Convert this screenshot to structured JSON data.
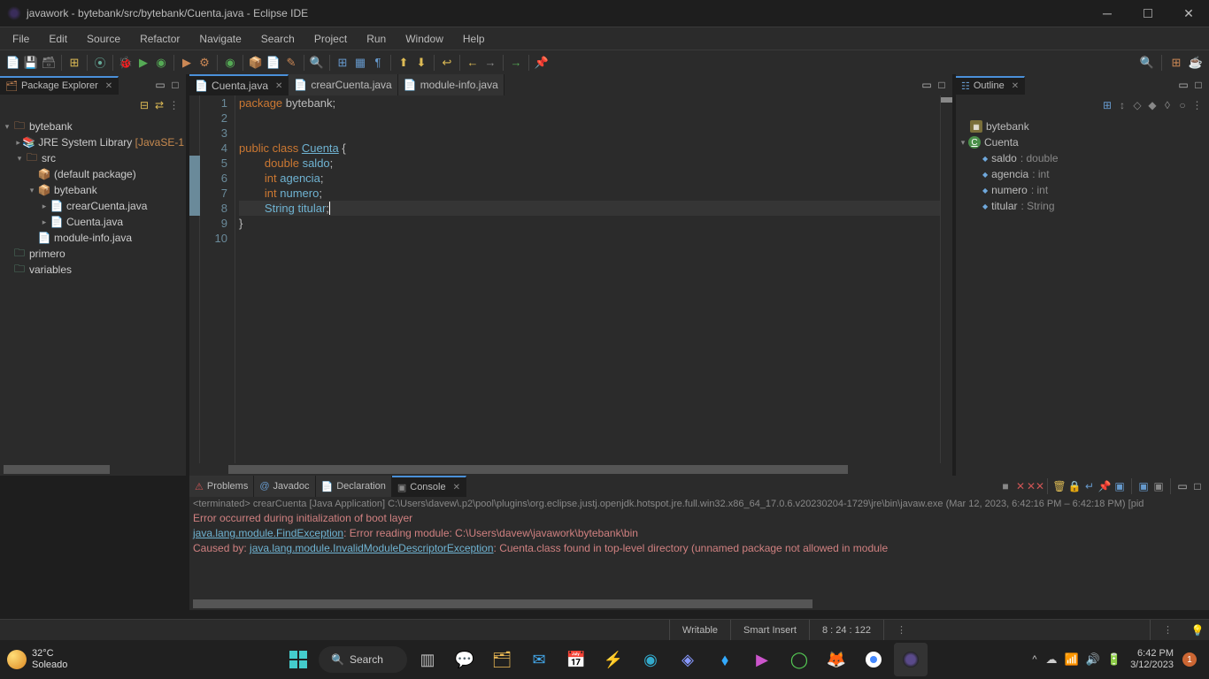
{
  "titlebar": {
    "title": "javawork - bytebank/src/bytebank/Cuenta.java - Eclipse IDE"
  },
  "menubar": [
    "File",
    "Edit",
    "Source",
    "Refactor",
    "Navigate",
    "Search",
    "Project",
    "Run",
    "Window",
    "Help"
  ],
  "package_explorer": {
    "title": "Package Explorer",
    "project": "bytebank",
    "jre": "JRE System Library",
    "jre_ver": "[JavaSE-1",
    "src": "src",
    "default_pkg": "(default package)",
    "pkg": "bytebank",
    "file1": "crearCuenta.java",
    "file2": "Cuenta.java",
    "file3": "module-info.java",
    "proj2": "primero",
    "proj3": "variables"
  },
  "editor_tabs": {
    "t1": "Cuenta.java",
    "t2": "crearCuenta.java",
    "t3": "module-info.java"
  },
  "code": {
    "l1": {
      "kw": "package",
      "rest": " bytebank;"
    },
    "l4_public": "public",
    "l4_class": "class",
    "l4_name": "Cuenta",
    "l4_brace": " {",
    "l5_type": "double",
    "l5_name": "saldo",
    "l5_semi": ";",
    "l6_type": "int",
    "l6_name": "agencia",
    "l6_semi": ";",
    "l7_type": "int",
    "l7_name": "numero",
    "l7_semi": ";",
    "l8_type": "String",
    "l8_name": "titular",
    "l8_semi": ";",
    "l9": "}"
  },
  "line_nums": [
    "1",
    "2",
    "3",
    "4",
    "5",
    "6",
    "7",
    "8",
    "9",
    "10"
  ],
  "outline": {
    "title": "Outline",
    "pkg": "bytebank",
    "cls": "Cuenta",
    "m1_n": "saldo",
    "m1_t": ": double",
    "m2_n": "agencia",
    "m2_t": ": int",
    "m3_n": "numero",
    "m3_t": ": int",
    "m4_n": "titular",
    "m4_t": ": String"
  },
  "bottom_tabs": {
    "problems": "Problems",
    "javadoc": "Javadoc",
    "declaration": "Declaration",
    "console": "Console"
  },
  "console": {
    "meta": "<terminated> crearCuenta [Java Application] C:\\Users\\davew\\.p2\\pool\\plugins\\org.eclipse.justj.openjdk.hotspot.jre.full.win32.x86_64_17.0.6.v20230204-1729\\jre\\bin\\javaw.exe  (Mar 12, 2023, 6:42:16 PM – 6:42:18 PM) [pid",
    "l1": "Error occurred during initialization of boot layer",
    "l2_link": "java.lang.module.FindException",
    "l2_rest": ": Error reading module: C:\\Users\\davew\\javawork\\bytebank\\bin",
    "l3_pre": "Caused by: ",
    "l3_link": "java.lang.module.InvalidModuleDescriptorException",
    "l3_rest": ": Cuenta.class found in top-level directory (unnamed package not allowed in module"
  },
  "status": {
    "writable": "Writable",
    "insert": "Smart Insert",
    "pos": "8 : 24 : 122"
  },
  "taskbar": {
    "temp": "32°C",
    "cond": "Soleado",
    "search": "Search",
    "time": "6:42 PM",
    "date": "3/12/2023",
    "notif": "1"
  }
}
